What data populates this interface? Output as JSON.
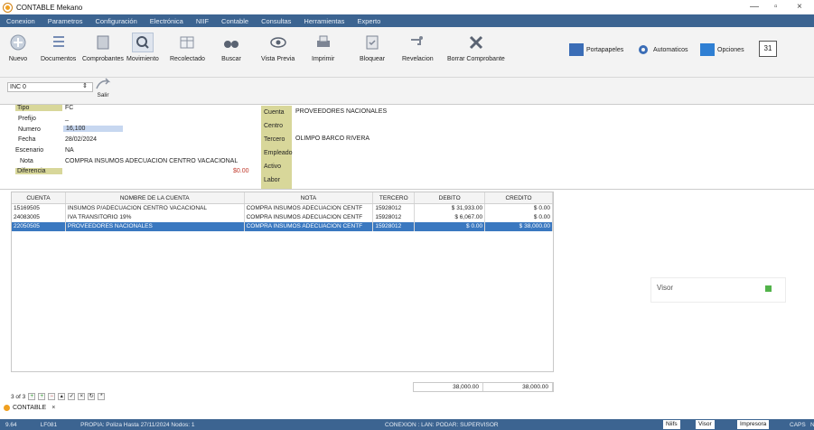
{
  "window": {
    "title": "CONTABLE Mekano",
    "controls": [
      "—",
      "▫",
      "×"
    ]
  },
  "menu": [
    "Conexion",
    "Parametros",
    "Configuración",
    "Electrónica",
    "NIIF",
    "Contable",
    "Consultas",
    "Herramientas",
    "Experto"
  ],
  "toolbar": [
    {
      "label": "Nuevo"
    },
    {
      "label": "Documentos"
    },
    {
      "label": "Comprobantes"
    },
    {
      "label": "Movimiento"
    },
    {
      "label": "Recolectado"
    },
    {
      "label": "Buscar"
    },
    {
      "label": "Vista Previa"
    },
    {
      "label": "Imprimir"
    },
    {
      "label": "Bloquear"
    },
    {
      "label": "Revelacion"
    },
    {
      "label": "Borrar Comprobante"
    }
  ],
  "right_toolbar": [
    "Portapapeles",
    "Automaticos",
    "Opciones",
    "31"
  ],
  "inc_value": "INC 0",
  "salir_label": "Salir",
  "form": {
    "tipo_label": "Tipo",
    "tipo_value": "FC",
    "prefijo_label": "Prefijo",
    "prefijo_value": "_",
    "numero_label": "Numero",
    "numero_value": "16,100",
    "fecha_label": "Fecha",
    "fecha_value": "28/02/2024",
    "escenario_label": "Escenario",
    "escenario_value": "NA",
    "nota_label": "Nota",
    "nota_value": "COMPRA INSUMOS ADECUACION CENTRO VACACIONAL",
    "diferencia_label": "Diferencia",
    "diferencia_value": "$0.00",
    "right_labels": [
      "Cuenta",
      "Centro",
      "Tercero",
      "Empleado",
      "Activo",
      "Labor"
    ],
    "cuenta_value": "PROVEEDORES NACIONALES",
    "tercero_value": "OLIMPO BARCO RIVERA"
  },
  "grid": {
    "headers": [
      "CUENTA",
      "NOMBRE DE LA CUENTA",
      "NOTA",
      "TERCERO",
      "DEBITO",
      "CREDITO"
    ],
    "rows": [
      [
        "15169505",
        "INSUMOS P/ADECUACION CENTRO VACACIONAL",
        "COMPRA INSUMOS ADECUACION CENTF",
        "15928012",
        "$ 31,933.00",
        "$ 0.00"
      ],
      [
        "24083005",
        "IVA TRANSITORIO 19%",
        "COMPRA INSUMOS ADECUACION CENTF",
        "15928012",
        "$ 6,067.00",
        "$ 0.00"
      ],
      [
        "22050505",
        "PROVEEDORES NACIONALES",
        "COMPRA INSUMOS ADECUACION CENTF",
        "15928012",
        "$ 0.00",
        "$ 38,000.00"
      ]
    ],
    "totals": [
      "38,000.00",
      "38,000.00"
    ]
  },
  "visor_label": "Visor",
  "nav_text": "3 of 3",
  "tabs": [
    "CONTABLE"
  ],
  "status": {
    "left": "9.64",
    "code": "LF081",
    "info": "PROPIA: Poliza Hasta 27/11/2024  Nodos: 1",
    "conn": "CONEXION : LAN: PODAR: SUPERVISOR",
    "niifs": "Niifs",
    "visor": "Visor",
    "impresora": "Impresora",
    "caps": "CAPS",
    "num": "N"
  }
}
